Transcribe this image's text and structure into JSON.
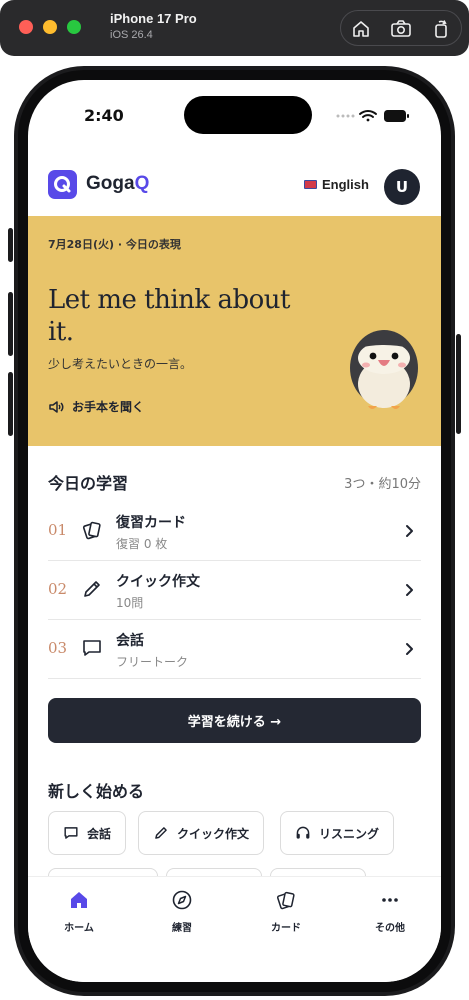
{
  "simulator": {
    "device_name": "iPhone 17 Pro",
    "os_version": "iOS 26.4"
  },
  "status_bar": {
    "time": "2:40"
  },
  "header": {
    "logo_letter": "Q",
    "app_name_prefix": "Goga",
    "app_name_suffix": "Q",
    "language_label": "English",
    "avatar_initial": "U",
    "accent_color": "#5849e8"
  },
  "hero": {
    "date_label": "7月28日(火) · 今日の表現",
    "phrase": "Let me think about it.",
    "translation": "少し考えたいときの一言。",
    "listen_label": "お手本を聞く",
    "background_color": "#e8c46a"
  },
  "today": {
    "title": "今日の学習",
    "meta": "3つ・約10分",
    "tasks": [
      {
        "num": "01",
        "icon": "cards-icon",
        "title": "復習カード",
        "sub": "復習 0 枚"
      },
      {
        "num": "02",
        "icon": "pencil-icon",
        "title": "クイック作文",
        "sub": "10問"
      },
      {
        "num": "03",
        "icon": "chat-icon",
        "title": "会話",
        "sub": "フリートーク"
      }
    ],
    "continue_label": "学習を続ける →"
  },
  "start_new": {
    "title": "新しく始める",
    "chips": [
      {
        "icon": "chat-icon",
        "label": "会話"
      },
      {
        "icon": "pencil-icon",
        "label": "クイック作文"
      },
      {
        "icon": "headphones-icon",
        "label": "リスニング"
      }
    ]
  },
  "tabbar": {
    "tabs": [
      {
        "icon": "home-icon",
        "label": "ホーム",
        "active": true
      },
      {
        "icon": "compass-icon",
        "label": "練習"
      },
      {
        "icon": "cards-icon",
        "label": "カード"
      },
      {
        "icon": "more-icon",
        "label": "その他"
      }
    ]
  }
}
